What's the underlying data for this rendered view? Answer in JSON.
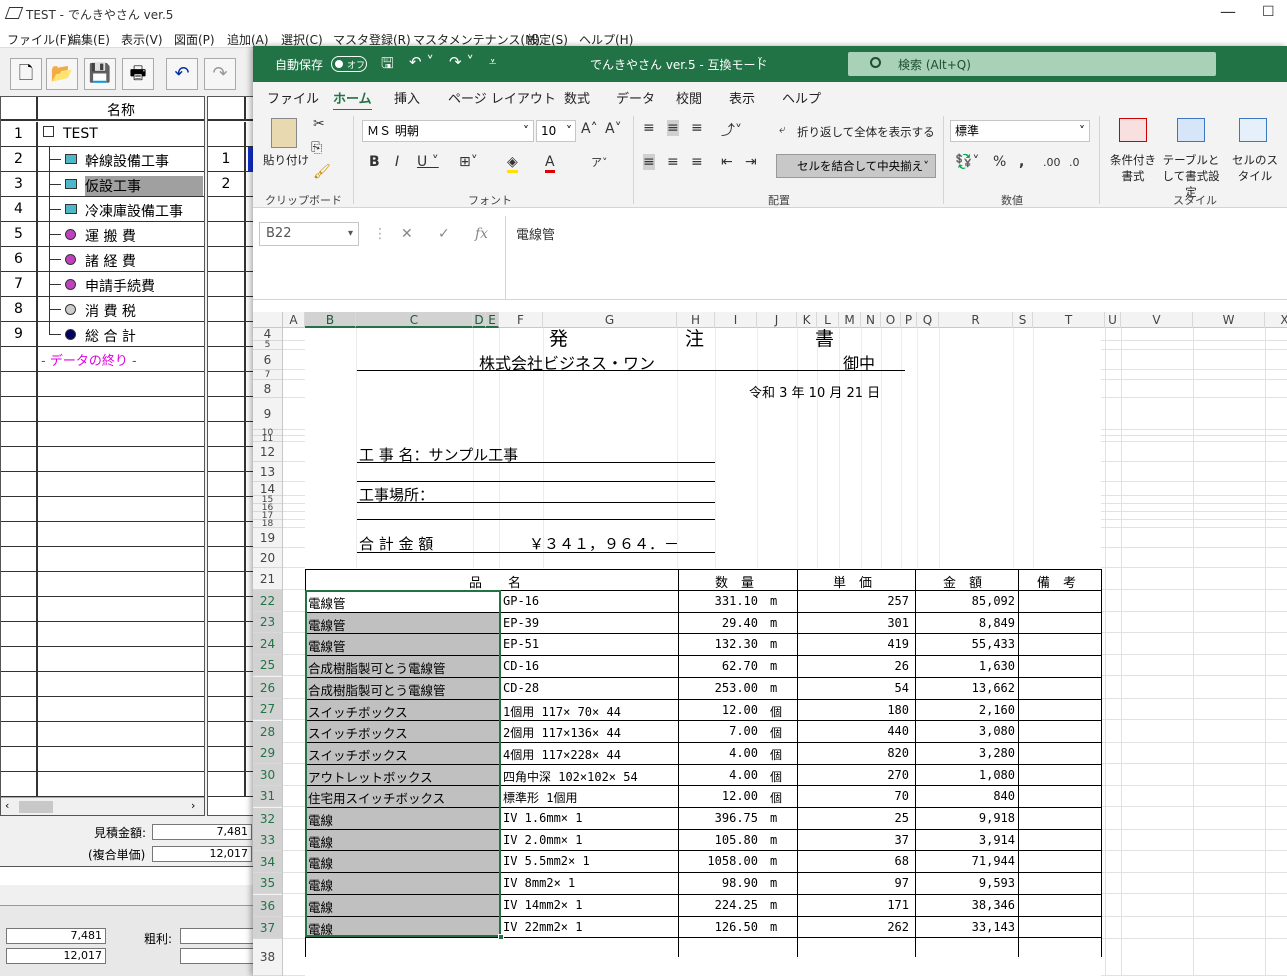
{
  "bg_app": {
    "title": "TEST - でんきやさん ver.5",
    "menu": [
      "ファイル(F)",
      "編集(E)",
      "表示(V)",
      "図面(P)",
      "追加(A)",
      "選択(C)",
      "マスタ登録(R)",
      "マスタメンテナンス(M)",
      "設定(S)",
      "ヘルプ(H)"
    ],
    "tree_header": "名称",
    "tree": [
      {
        "num": "1",
        "label": "TEST"
      },
      {
        "num": "2",
        "label": "幹線設備工事"
      },
      {
        "num": "3",
        "label": "仮設工事"
      },
      {
        "num": "4",
        "label": "冷凍庫設備工事"
      },
      {
        "num": "5",
        "label": "運 搬 費"
      },
      {
        "num": "6",
        "label": "諸 経 費"
      },
      {
        "num": "7",
        "label": "申請手続費"
      },
      {
        "num": "8",
        "label": "消 費 税"
      },
      {
        "num": "9",
        "label": "総 合 計"
      }
    ],
    "end_label": "- データの終り -",
    "mid_nums": [
      "1",
      "2"
    ],
    "estimate_label": "見積金額:",
    "estimate_value": "7,481",
    "unit_label": "(複合単価)",
    "unit_value": "12,017",
    "bottom_value1": "7,481",
    "bottom_value2": "12,017",
    "profit_label": "粗利:"
  },
  "excel": {
    "autosave": "自動保存",
    "autosave_state": "オフ",
    "title": "でんきやさん ver.5  -  互換モード",
    "search": "検索 (Alt+Q)",
    "tabs": [
      "ファイル",
      "ホーム",
      "挿入",
      "ページ レイアウト",
      "数式",
      "データ",
      "校閲",
      "表示",
      "ヘルプ"
    ],
    "ribbon": {
      "paste": "貼り付け",
      "font_name": "ＭＳ 明朝",
      "font_size": "10",
      "wrap": "折り返して全体を表示する",
      "merge": "セルを結合して中央揃え",
      "number_format": "標準",
      "cond_format": "条件付き書式",
      "table_format": "テーブルとして書式設定",
      "cell_style": "セルのスタイル",
      "groups": [
        "クリップボード",
        "フォント",
        "配置",
        "数値",
        "スタイル"
      ]
    },
    "name_box": "B22",
    "formula": "電線管",
    "columns": [
      "A",
      "B",
      "C",
      "D",
      "E",
      "F",
      "G",
      "H",
      "I",
      "J",
      "K",
      "L",
      "M",
      "N",
      "O",
      "P",
      "Q",
      "R",
      "S",
      "T",
      "U",
      "V",
      "W",
      "X"
    ],
    "rows": [
      "4",
      "5",
      "6",
      "7",
      "8",
      "9",
      "10",
      "11",
      "12",
      "13",
      "14",
      "15",
      "16",
      "17",
      "18",
      "19",
      "20",
      "21",
      "22",
      "23",
      "24",
      "25",
      "26",
      "27",
      "28",
      "29",
      "30",
      "31",
      "32",
      "33",
      "34",
      "35",
      "36",
      "37",
      "38"
    ]
  },
  "doc": {
    "title_chars": [
      "発",
      "注",
      "書"
    ],
    "company": "株式会社ビジネス・ワン",
    "honorific": "御中",
    "date": "令和  3 年    10 月   21 日",
    "project_name": "工 事 名：サンプル工事",
    "project_site": "工事場所：",
    "total_label": "合  計  金  額",
    "total_value": "￥３４１，９６４．－",
    "headers": {
      "item": "品　　名",
      "qty": "数　量",
      "price": "単　価",
      "amount": "金　額",
      "note": "備　考"
    },
    "items": [
      {
        "name": "電線管",
        "spec": "GP-16",
        "qty": "331.10",
        "unit": "m",
        "price": "257",
        "amount": "85,092"
      },
      {
        "name": "電線管",
        "spec": "EP-39",
        "qty": "29.40",
        "unit": "m",
        "price": "301",
        "amount": "8,849"
      },
      {
        "name": "電線管",
        "spec": "EP-51",
        "qty": "132.30",
        "unit": "m",
        "price": "419",
        "amount": "55,433"
      },
      {
        "name": "合成樹脂製可とう電線管",
        "spec": "CD-16",
        "qty": "62.70",
        "unit": "m",
        "price": "26",
        "amount": "1,630"
      },
      {
        "name": "合成樹脂製可とう電線管",
        "spec": "CD-28",
        "qty": "253.00",
        "unit": "m",
        "price": "54",
        "amount": "13,662"
      },
      {
        "name": "スイッチボックス",
        "spec": "1個用  117× 70× 44",
        "qty": "12.00",
        "unit": "個",
        "price": "180",
        "amount": "2,160"
      },
      {
        "name": "スイッチボックス",
        "spec": "2個用  117×136× 44",
        "qty": "7.00",
        "unit": "個",
        "price": "440",
        "amount": "3,080"
      },
      {
        "name": "スイッチボックス",
        "spec": "4個用  117×228× 44",
        "qty": "4.00",
        "unit": "個",
        "price": "820",
        "amount": "3,280"
      },
      {
        "name": "アウトレットボックス",
        "spec": "四角中深  102×102× 54",
        "qty": "4.00",
        "unit": "個",
        "price": "270",
        "amount": "1,080"
      },
      {
        "name": "住宅用スイッチボックス",
        "spec": "標準形 1個用",
        "qty": "12.00",
        "unit": "個",
        "price": "70",
        "amount": "840"
      },
      {
        "name": "電線",
        "spec": "IV 1.6mm× 1",
        "qty": "396.75",
        "unit": "m",
        "price": "25",
        "amount": "9,918"
      },
      {
        "name": "電線",
        "spec": "IV 2.0mm× 1",
        "qty": "105.80",
        "unit": "m",
        "price": "37",
        "amount": "3,914"
      },
      {
        "name": "電線",
        "spec": "IV 5.5mm2× 1",
        "qty": "1058.00",
        "unit": "m",
        "price": "68",
        "amount": "71,944"
      },
      {
        "name": "電線",
        "spec": "IV 8mm2× 1",
        "qty": "98.90",
        "unit": "m",
        "price": "97",
        "amount": "9,593"
      },
      {
        "name": "電線",
        "spec": "IV 14mm2× 1",
        "qty": "224.25",
        "unit": "m",
        "price": "171",
        "amount": "38,346"
      },
      {
        "name": "電線",
        "spec": "IV 22mm2× 1",
        "qty": "126.50",
        "unit": "m",
        "price": "262",
        "amount": "33,143"
      }
    ]
  }
}
